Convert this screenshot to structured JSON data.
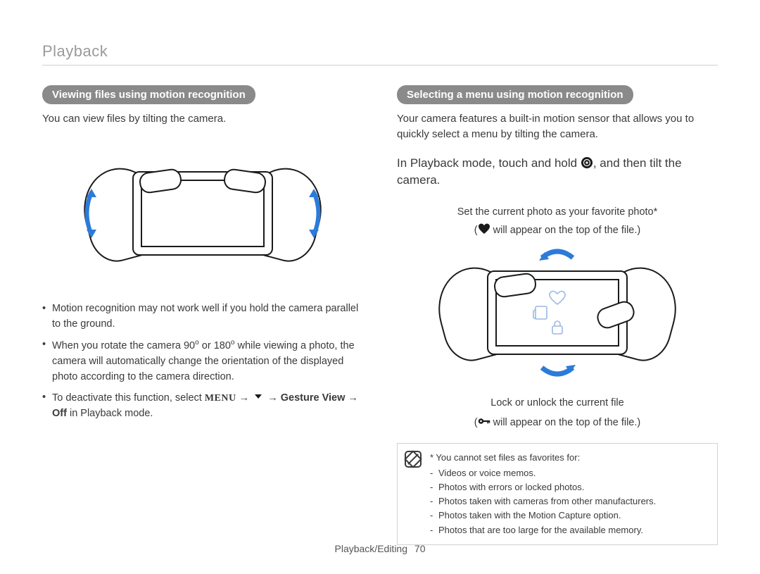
{
  "header": {
    "section": "Playback"
  },
  "left": {
    "heading": "Viewing files using motion recognition",
    "intro": "You can view files by tilting the camera.",
    "bullets": [
      {
        "text": "Motion recognition may not work well if you hold the camera parallel to the ground."
      },
      {
        "text_html": "When you rotate the camera 90<sup>o</sup> or 180<sup>o</sup> while viewing a photo, the camera will automatically change the orientation of the displayed photo according to the camera direction."
      },
      {
        "prefix": "To deactivate this function, select ",
        "menu_word": "MENU",
        "arrow1": " → ",
        "gesture_bold": "Gesture View",
        "arrow2": " → ",
        "off_bold": "Off",
        "suffix": " in Playback mode."
      }
    ]
  },
  "right": {
    "heading": "Selecting a menu using motion recognition",
    "intro": "Your camera features a built-in motion sensor that allows you to quickly select a menu by tilting the camera.",
    "instruction_prefix": "In Playback mode, touch and hold ",
    "instruction_suffix": ", and then tilt the camera.",
    "favorite_line1": "Set the current photo as your favorite photo*",
    "favorite_line2_prefix": "(",
    "favorite_line2_suffix": " will appear on the top of the file.)",
    "lock_line1": "Lock or unlock the current file",
    "lock_line2_prefix": "(",
    "lock_line2_suffix": " will appear on the top of the file.)",
    "note": {
      "lead": "* You cannot set files as favorites for:",
      "items": [
        "Videos or voice memos.",
        "Photos with errors or locked photos.",
        "Photos taken with cameras from other manufacturers.",
        "Photos taken with the Motion Capture option.",
        "Photos that are too large for the available memory."
      ]
    }
  },
  "footer": {
    "section": "Playback/Editing",
    "page": "70"
  }
}
